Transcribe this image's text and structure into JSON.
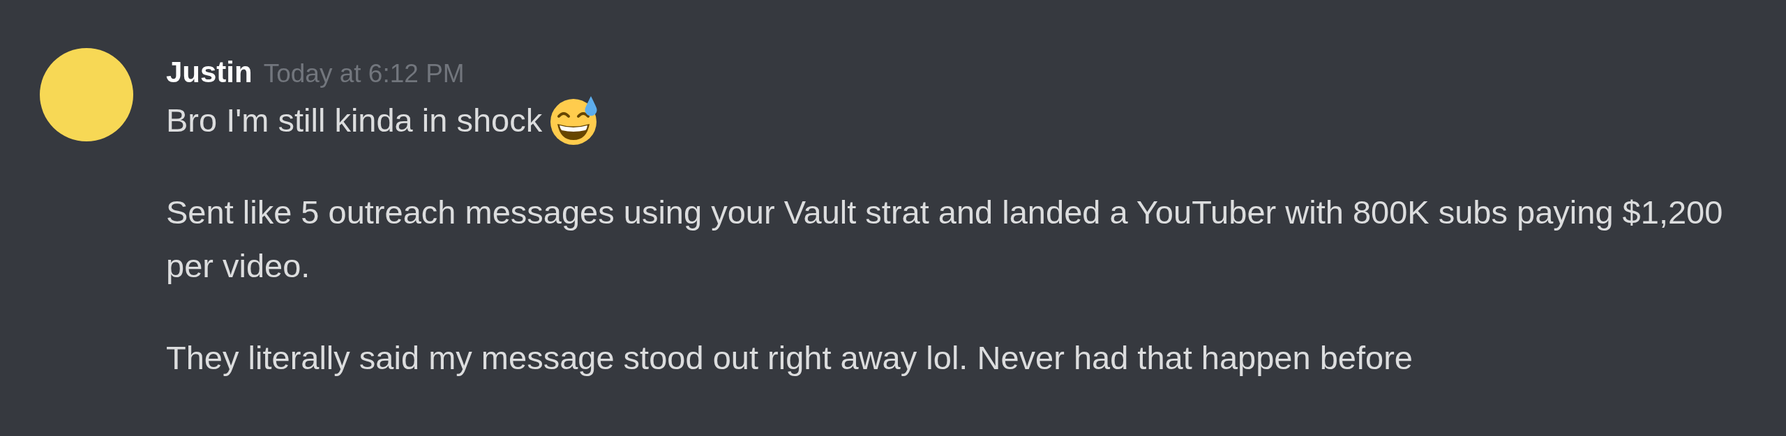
{
  "message": {
    "author": "Justin",
    "timestamp": "Today at 6:12 PM",
    "paragraphs": [
      {
        "text": "Bro I'm still kinda in shock",
        "trailing_emoji": true
      },
      {
        "text": "Sent like 5 outreach messages using your Vault strat and landed a YouTuber with 800K subs paying $1,200 per video.",
        "trailing_emoji": false
      },
      {
        "text": "They literally said my message stood out right away lol. Never had that happen before",
        "trailing_emoji": false
      }
    ]
  }
}
